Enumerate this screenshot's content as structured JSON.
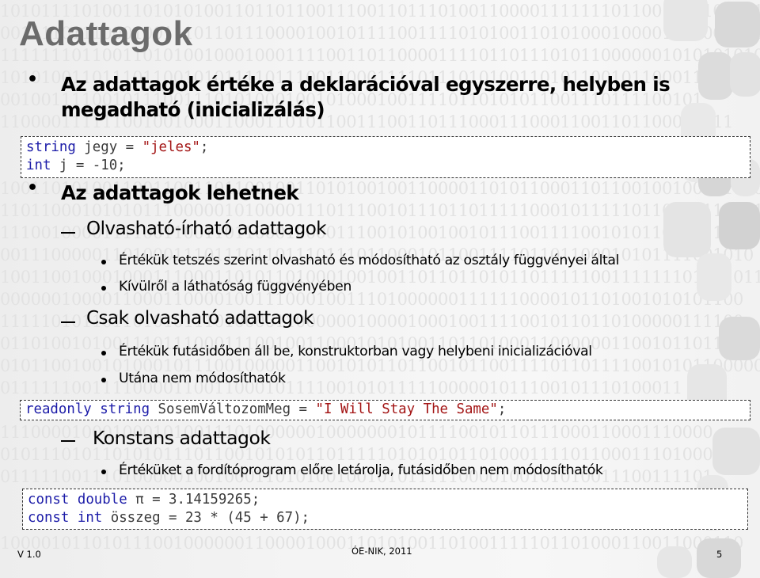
{
  "slide": {
    "title": "Adattagok",
    "bullets": [
      {
        "level": 1,
        "lines": [
          "Az adattagok értéke a deklarációval egyszerre, helyben is",
          "megadható (inicializálás)"
        ]
      },
      {
        "level": 1,
        "lines": [
          "Az adattagok lehetnek"
        ]
      }
    ],
    "code_blocks": [
      {
        "lines": [
          [
            {
              "t": "kw",
              "v": "string"
            },
            {
              "t": "id",
              "v": " jegy = "
            },
            {
              "t": "str",
              "v": "\"jeles\""
            },
            {
              "t": "id",
              "v": ";"
            }
          ],
          [
            {
              "t": "kw",
              "v": "int"
            },
            {
              "t": "id",
              "v": " j = -10;"
            }
          ]
        ]
      },
      {
        "lines": [
          [
            {
              "t": "kw",
              "v": "readonly"
            },
            {
              "t": "id",
              "v": " "
            },
            {
              "t": "kw",
              "v": "string"
            },
            {
              "t": "id",
              "v": " SosemVáltozomMeg = "
            },
            {
              "t": "str",
              "v": "\"I Will Stay The Same\""
            },
            {
              "t": "id",
              "v": ";"
            }
          ]
        ]
      },
      {
        "lines": [
          [
            {
              "t": "kw",
              "v": "const"
            },
            {
              "t": "id",
              "v": " "
            },
            {
              "t": "kw",
              "v": "double"
            },
            {
              "t": "id",
              "v": " π = 3.14159265;"
            }
          ],
          [
            {
              "t": "kw",
              "v": "const"
            },
            {
              "t": "id",
              "v": " "
            },
            {
              "t": "kw",
              "v": "int"
            },
            {
              "t": "id",
              "v": " összeg = 23 * (45 + 67);"
            }
          ]
        ]
      }
    ],
    "sections": [
      {
        "heading": "Olvasható-írható adattagok",
        "items": [
          "Értékük tetszés szerint olvasható és módosítható az osztály függvényei által",
          "Kívülről a láthatóság függvényében"
        ]
      },
      {
        "heading": "Csak olvasható adattagok",
        "items": [
          "Értékük futásidőben áll be, konstruktorban vagy helybeni inicializációval",
          "Utána nem módosíthatók"
        ]
      },
      {
        "heading": "Konstans adattagok",
        "items": [
          "Értéküket a fordítóprogram előre letárolja, futásidőben nem módosíthatók"
        ]
      }
    ],
    "footer": {
      "version": "V 1.0",
      "center": "ÓE-NIK, 2011",
      "page_number": "5"
    },
    "background_binary_rows": [
      "101011110100110101010011011011001110011011101001100001111111011001000100101",
      "001111011100010011101101110000100101111001111010100110101000100001000000001100",
      "111111101100110101001000100011110011011000011110110111010110000001010101010",
      "101010011011101100101011110111001100011110111010100110101100101100011010",
      "001001111001011100111010100010010100010011110110101011001110111100101",
      "110000111111001001000110001101011001110011011100011100011001101100001111",
      "",
      "",
      "1001101010011001100110110010011010100100110000110101100011011001001000111001",
      "110110001010101110000010100001110111001011101101111100010111110110001111101",
      "111001000011110011001101100010000111001010010010111001111001010110100110010",
      "00111000001101000111011101101110111011000101100111101101100010101111001010",
      "100110010001000111000110101101000100100110110110101101111100111111101011011",
      "0000001000011000110000100111000100111010000001111110000101101001010101100",
      "1111101011011010101110100001100000010000100010011110010110110100000111100",
      "0110100101001110111000111001001100010101001101101000110000001100101101101",
      "0101100100101000101110010000011001010110110010110011110110111100101011000000",
      "0111111001111000011001100010111100101011111000001011100101110100011",
      "",
      "1110000100010001010011101000000100000001011110010110111000110001110000",
      "0101110101101010111011001010101101111101010101101000111101100011101000",
      "0111110011101000001001000110101001001010111110000100101010011100111101",
      "",
      "",
      "1000010110101110010000001100001000110101001101001111101101000110011000110"
    ]
  }
}
